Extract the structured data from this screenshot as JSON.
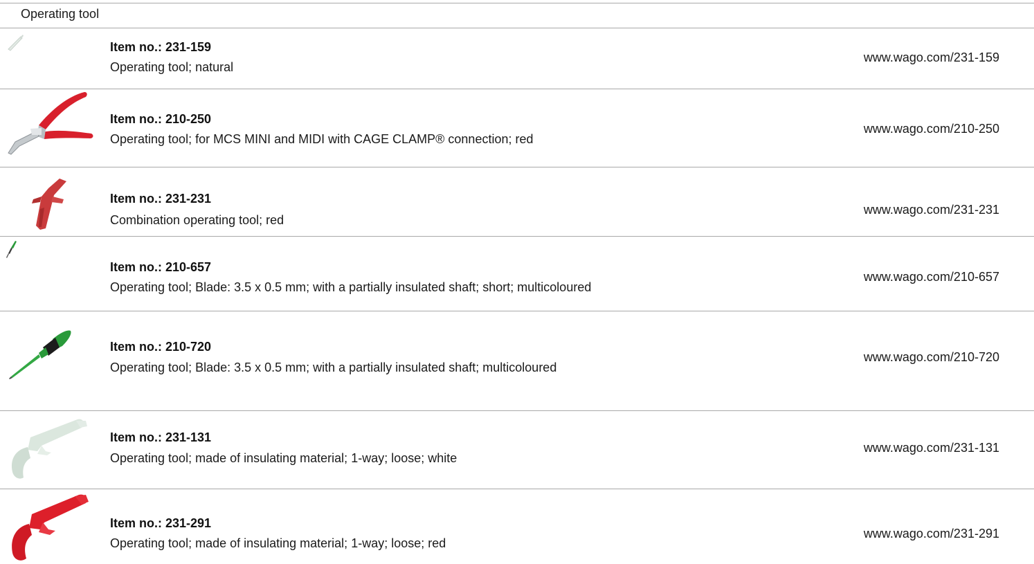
{
  "section": {
    "title": "Operating tool"
  },
  "items": [
    {
      "item_no": "Item no.: 231-159",
      "description": "Operating tool; natural",
      "link": "www.wago.com/231-159",
      "image_icon": "slim-operating-tool-natural-icon"
    },
    {
      "item_no": "Item no.: 210-250",
      "description": "Operating tool; for MCS MINI and MIDI with CAGE CLAMP® connection; red",
      "link": "www.wago.com/210-250",
      "image_icon": "pliers-red-icon"
    },
    {
      "item_no": "Item no.: 231-231",
      "description": "Combination operating tool; red",
      "link": "www.wago.com/231-231",
      "image_icon": "combination-tool-red-icon"
    },
    {
      "item_no": "Item no.: 210-657",
      "description": "Operating tool; Blade: 3.5 x 0.5 mm; with a partially insulated shaft; short; multicoloured",
      "link": "www.wago.com/210-657",
      "image_icon": "short-screwdriver-green-icon"
    },
    {
      "item_no": "Item no.: 210-720",
      "description": "Operating tool; Blade: 3.5 x 0.5 mm; with a partially insulated shaft; multicoloured",
      "link": "www.wago.com/210-720",
      "image_icon": "screwdriver-green-black-icon"
    },
    {
      "item_no": "Item no.: 231-131",
      "description": "Operating tool; made of insulating material; 1-way; loose; white",
      "link": "www.wago.com/231-131",
      "image_icon": "hook-tool-white-icon"
    },
    {
      "item_no": "Item no.: 231-291",
      "description": "Operating tool; made of insulating material; 1-way; loose; red",
      "link": "www.wago.com/231-291",
      "image_icon": "hook-tool-red-icon"
    }
  ],
  "colors": {
    "divider": "#a8a8a8",
    "text": "#1a1a1a",
    "tool_red": "#d8202c",
    "tool_green": "#2a9a3a"
  }
}
